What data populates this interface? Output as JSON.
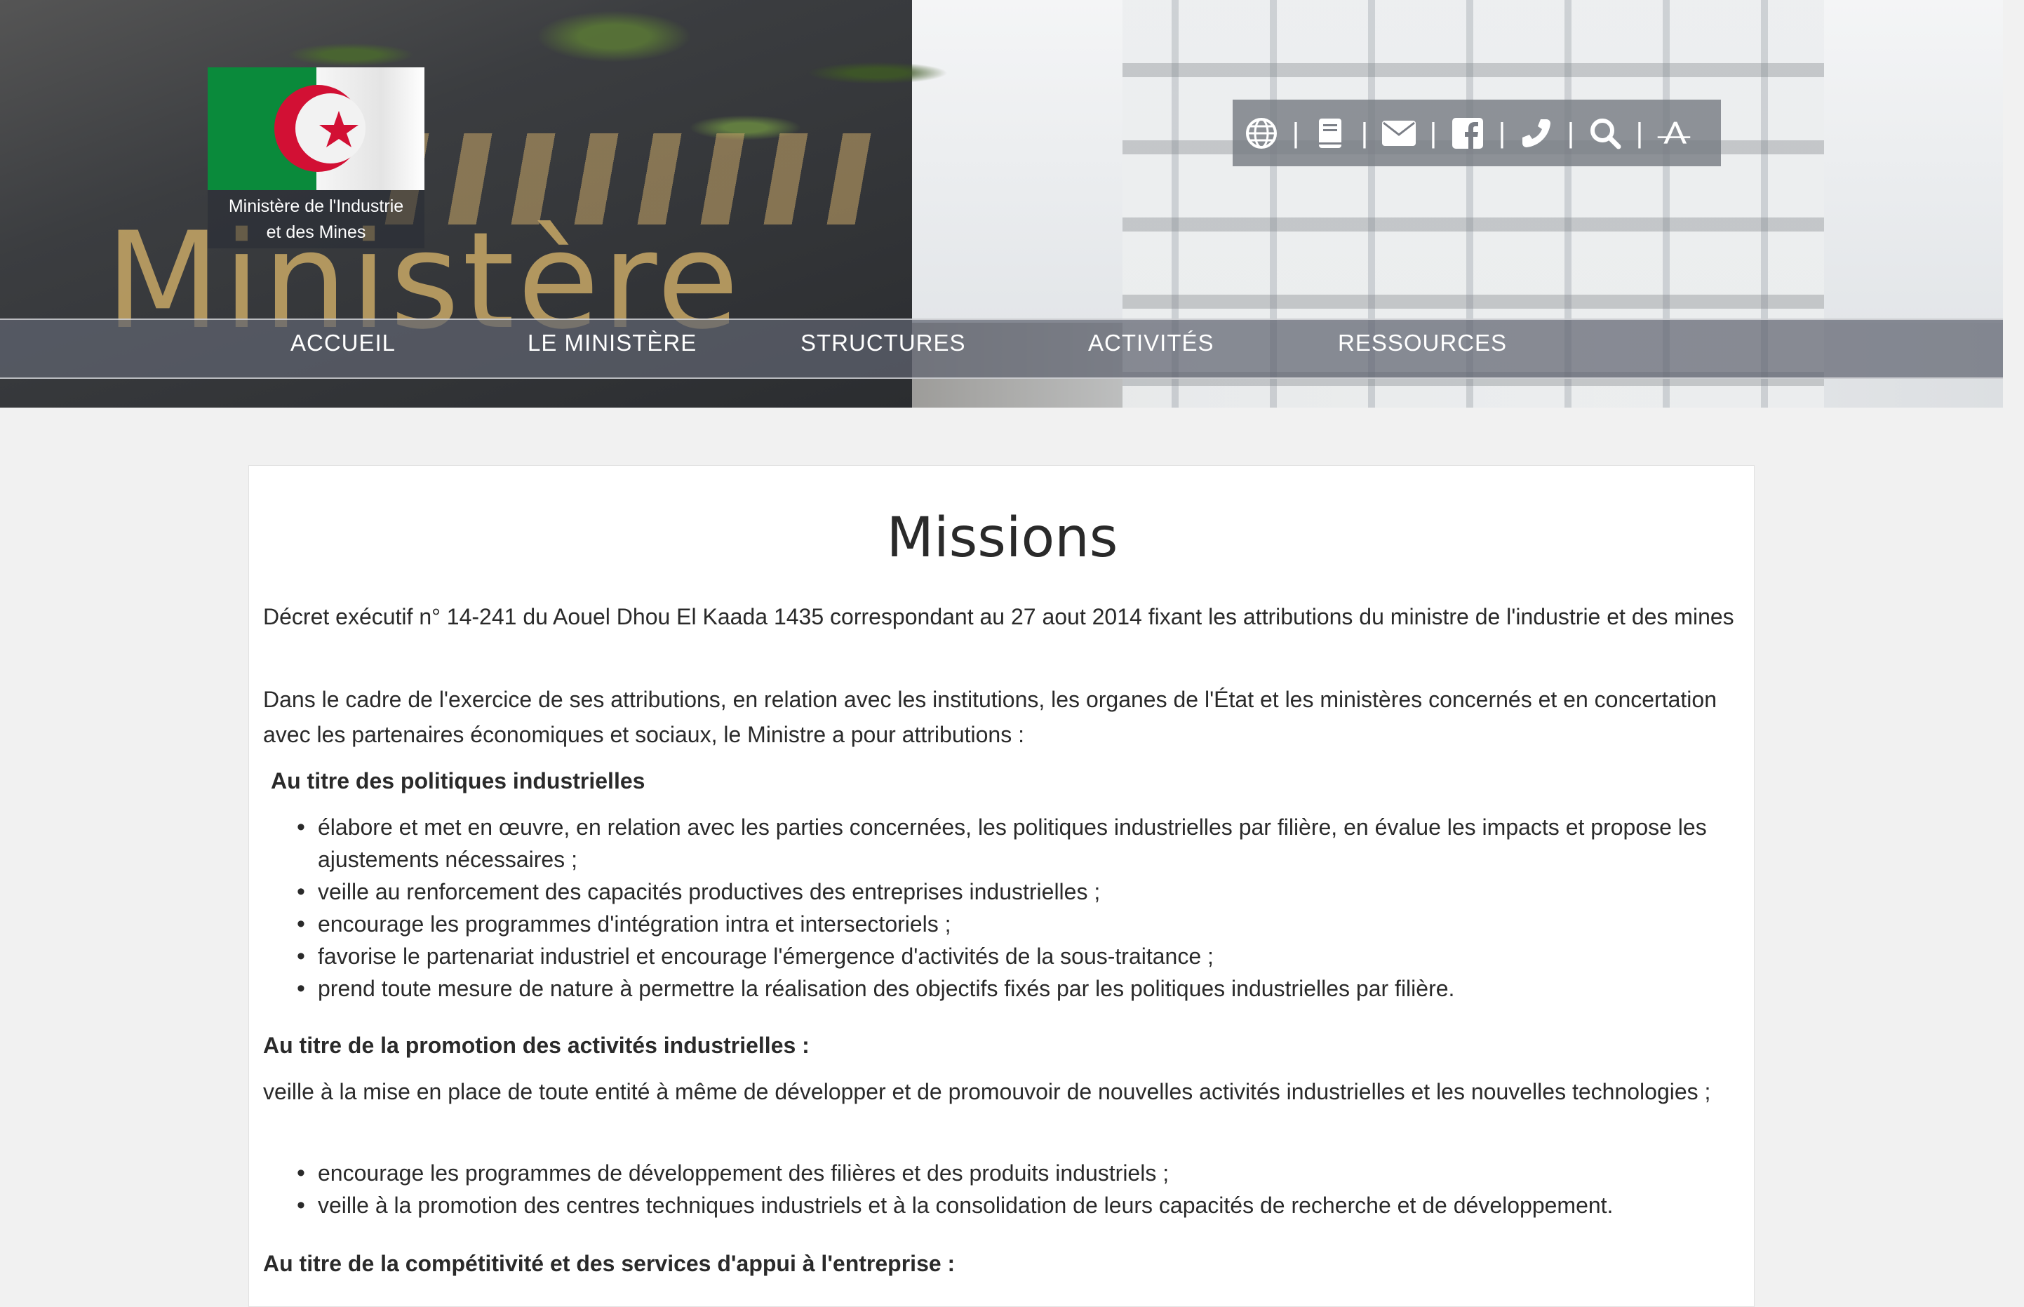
{
  "header": {
    "logo_text_line1": "Ministère de l'Industrie",
    "logo_text_line2": "et des Mines",
    "banner_text": "Ministère",
    "icons": [
      "globe-icon",
      "book-icon",
      "envelope-icon",
      "facebook-icon",
      "phone-icon",
      "search-icon",
      "font-size-icon"
    ]
  },
  "nav": {
    "items": [
      "ACCUEIL",
      "LE MINISTÈRE",
      "STRUCTURES",
      "ACTIVITÉS",
      "RESSOURCES"
    ]
  },
  "content": {
    "title": "Missions",
    "p1": "Décret exécutif n° 14-241 du Aouel Dhou El Kaada 1435 correspondant au 27 aout 2014 fixant les attributions du ministre de l'industrie et des mines",
    "p2": "Dans le cadre de l'exercice de ses attributions, en relation avec les institutions, les organes de l'État et les ministères concernés et en concertation avec les partenaires économiques et sociaux, le Ministre a pour attributions :",
    "h1": "Au titre des politiques industrielles",
    "list1": [
      "élabore et met en œuvre, en relation avec les parties concernées, les politiques industrielles par filière, en évalue les impacts et propose les ajustements nécessaires ;",
      "veille au renforcement des capacités productives des entreprises industrielles ;",
      "encourage les programmes d'intégration intra et intersectoriels ;",
      "favorise le partenariat industriel et encourage l'émergence d'activités de la sous-traitance ;",
      "prend toute mesure de nature à permettre la réalisation des objectifs fixés par les politiques industrielles par filière."
    ],
    "h2": "Au titre de la promotion des activités industrielles :",
    "p3": "veille à la mise en place de toute entité à même de développer et de promouvoir de nouvelles activités industrielles et les nouvelles technologies ;",
    "list2": [
      "encourage les programmes de développement des filières et des produits industriels ;",
      "veille à la promotion des centres techniques industriels et à la consolidation de leurs capacités de recherche et de développement."
    ],
    "h3": "Au titre de la compétitivité et des services d'appui à l'entreprise :"
  },
  "colors": {
    "flag_green": "#0a8a3b",
    "flag_red": "#d21034",
    "page_bg": "#f1f1f1",
    "card_bg": "#ffffff"
  }
}
